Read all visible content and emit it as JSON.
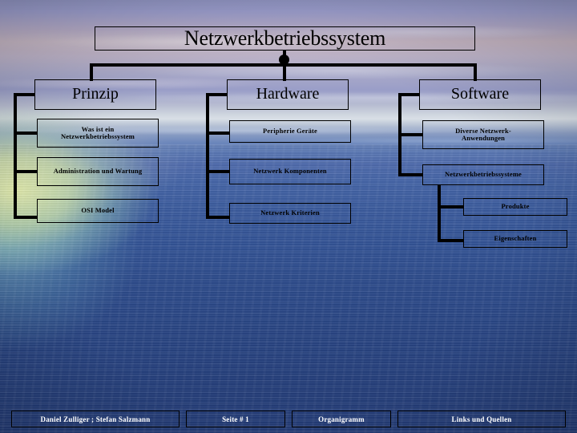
{
  "slide": {
    "title": "Netzwerkbetriebssystem",
    "background_description": "sunset sky over ocean photograph",
    "colors": {
      "line": "#000000",
      "text": "#000000",
      "footer_text": "#ffffff",
      "sky_top": "#8f93c0",
      "horizon": "#d9dfe6",
      "water_bottom": "#243c76"
    }
  },
  "branches": [
    {
      "id": "prinzip",
      "label": "Prinzip",
      "children": [
        {
          "label": "Was ist ein Netzwerkbetriebssystem",
          "line1": "Was ist ein",
          "line2": "Netzwerkbetriebssystem"
        },
        {
          "label": "Administration und Wartung",
          "line1": "Administration und Wartung",
          "line2": ""
        },
        {
          "label": "OSI Model",
          "line1": "OSI Model",
          "line2": ""
        }
      ]
    },
    {
      "id": "hardware",
      "label": "Hardware",
      "children": [
        {
          "label": "Peripherie Geräte",
          "line1": "Peripherie Geräte",
          "line2": ""
        },
        {
          "label": "Netzwerk Komponenten",
          "line1": "Netzwerk Komponenten",
          "line2": ""
        },
        {
          "label": "Netzwerk Kriterien",
          "line1": "Netzwerk Kriterien",
          "line2": ""
        }
      ]
    },
    {
      "id": "software",
      "label": "Software",
      "children": [
        {
          "label": "Diverse Netzwerk-Anwendungen",
          "line1": "Diverse Netzwerk-",
          "line2": "Anwendungen"
        },
        {
          "label": "Netzwerkbetriebssysteme",
          "line1": "Netzwerkbetriebssysteme",
          "line2": ""
        }
      ],
      "grandchildren": [
        {
          "label": "Produkte"
        },
        {
          "label": "Eigenschaften"
        }
      ]
    }
  ],
  "footer": {
    "authors": "Daniel Zulliger ; Stefan Salzmann",
    "page": "Seite # 1",
    "section": "Organigramm",
    "links": "Links und Quellen"
  }
}
